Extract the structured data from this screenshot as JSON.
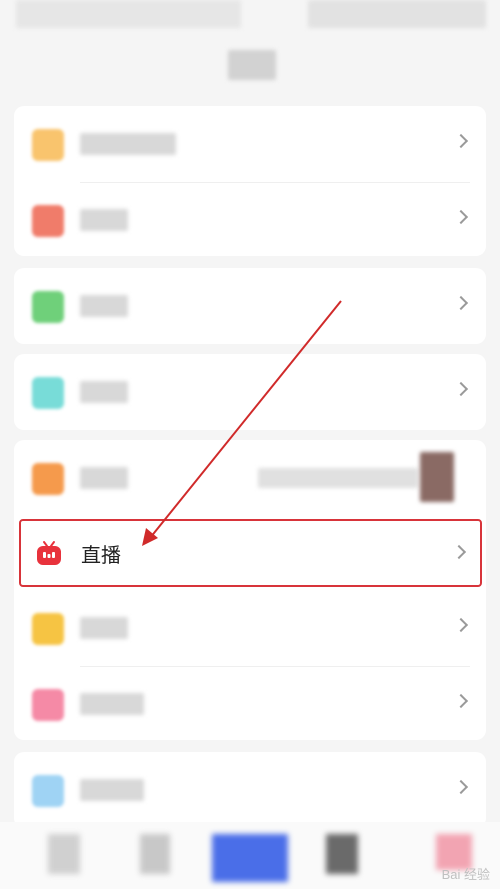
{
  "live_item": {
    "label": "直播",
    "icon": "tv-live-icon",
    "accent": "#e8323c"
  },
  "colors": {
    "highlight_border": "#d8343a",
    "arrow": "#d02a2a",
    "page_bg": "#f5f5f5"
  },
  "watermark": "Bai 经验"
}
